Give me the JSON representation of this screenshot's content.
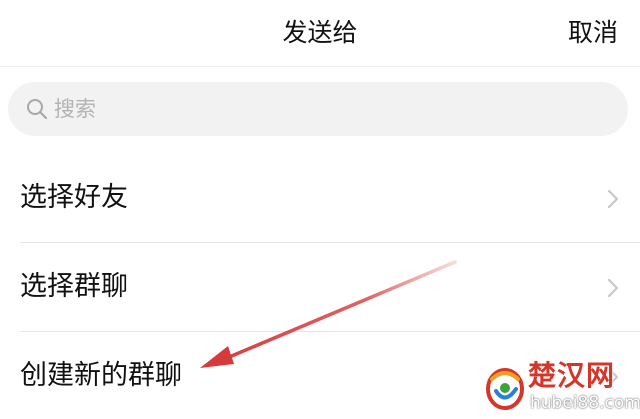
{
  "header": {
    "title": "发送给",
    "cancel_label": "取消"
  },
  "search": {
    "placeholder": "搜索",
    "icon": "search-icon"
  },
  "list": {
    "items": [
      {
        "label": "选择好友",
        "icon": "chevron-right-icon"
      },
      {
        "label": "选择群聊",
        "icon": "chevron-right-icon"
      },
      {
        "label": "创建新的群聊",
        "icon": "chevron-right-icon"
      }
    ]
  },
  "annotation": {
    "type": "arrow",
    "color": "#d63a3a"
  },
  "watermark": {
    "name": "楚汉网",
    "url": "hubei88.com",
    "name_color": "#d6352a"
  },
  "colors": {
    "background": "#ffffff",
    "search_bg": "#f2f2f2",
    "divider": "#e5e5e5",
    "placeholder": "#b3b3b3",
    "chevron": "#c7c7cc"
  }
}
